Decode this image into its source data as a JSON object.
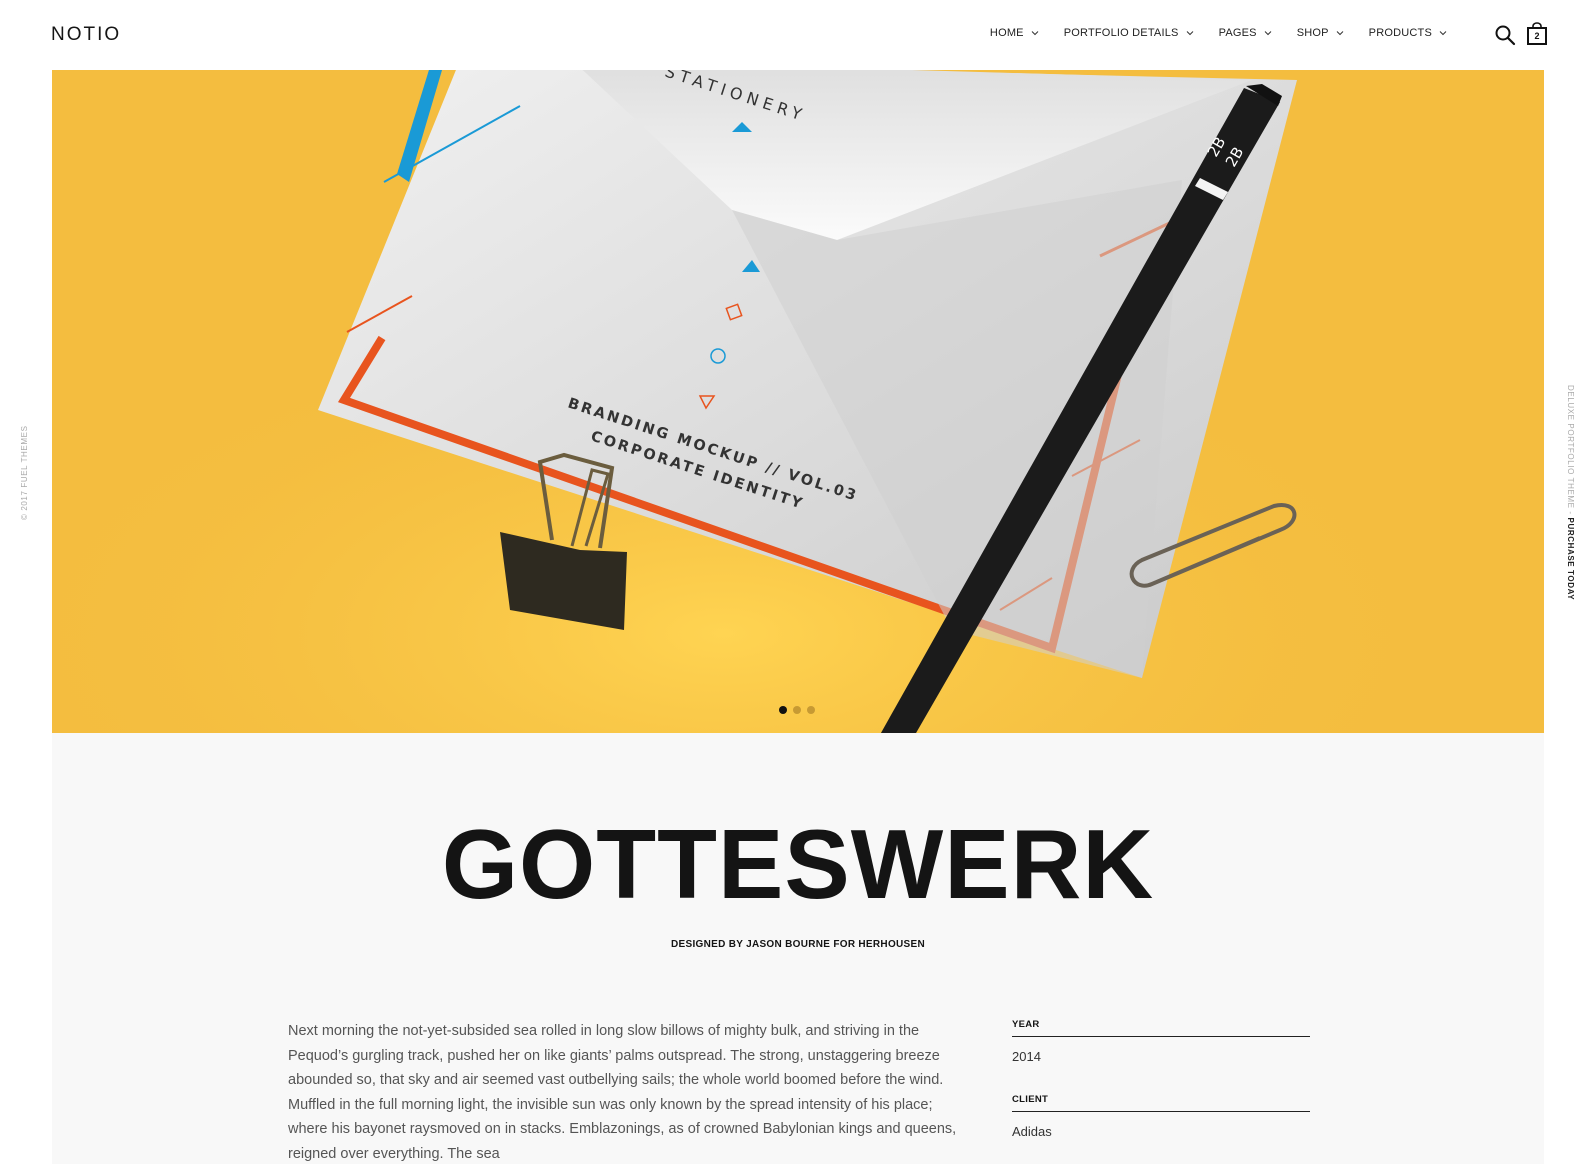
{
  "header": {
    "logo": "NOTIO",
    "nav": [
      {
        "label": "HOME"
      },
      {
        "label": "PORTFOLIO DETAILS"
      },
      {
        "label": "PAGES"
      },
      {
        "label": "SHOP"
      },
      {
        "label": "PRODUCTS"
      }
    ],
    "cart_count": "2",
    "icons": {
      "search": "search-icon",
      "cart": "shopping-bag-icon",
      "dropdown": "chevron-down-icon"
    }
  },
  "side": {
    "left": "© 2017 FUEL THEMES",
    "right_prefix": "DELUXE PORTFOLIO THEME - ",
    "right_link": "PURCHASE TODAY"
  },
  "hero": {
    "image_text": {
      "stationery": "STATIONERY",
      "line1": "BRANDING MOCKUP // VOL.03",
      "line2": "CORPORATE IDENTITY",
      "pencil": "2B",
      "pencil2": "2B"
    },
    "colors": {
      "background": "#f4bd3f",
      "accent_orange": "#e8541e",
      "accent_blue": "#1a9ad6"
    },
    "slider_dots": 3,
    "active_dot": 1
  },
  "project": {
    "title": "GOTTESWERK",
    "subtitle": "DESIGNED BY JASON BOURNE FOR HERHOUSEN",
    "description": "Next morning the not-yet-subsided sea rolled in long slow billows of mighty bulk, and striving in the Pequod’s gurgling track, pushed her on like giants’ palms outspread. The strong, unstaggering breeze abounded so, that sky and air seemed vast outbellying sails; the whole world boomed before the wind. Muffled in the full morning light, the invisible sun was only known by the spread intensity of his place; where his bayonet raysmoved on in stacks. Emblazonings, as of crowned Babylonian kings and queens, reigned over everything. The sea",
    "meta": [
      {
        "label": "YEAR",
        "value": "2014"
      },
      {
        "label": "CLIENT",
        "value": "Adidas"
      }
    ]
  }
}
